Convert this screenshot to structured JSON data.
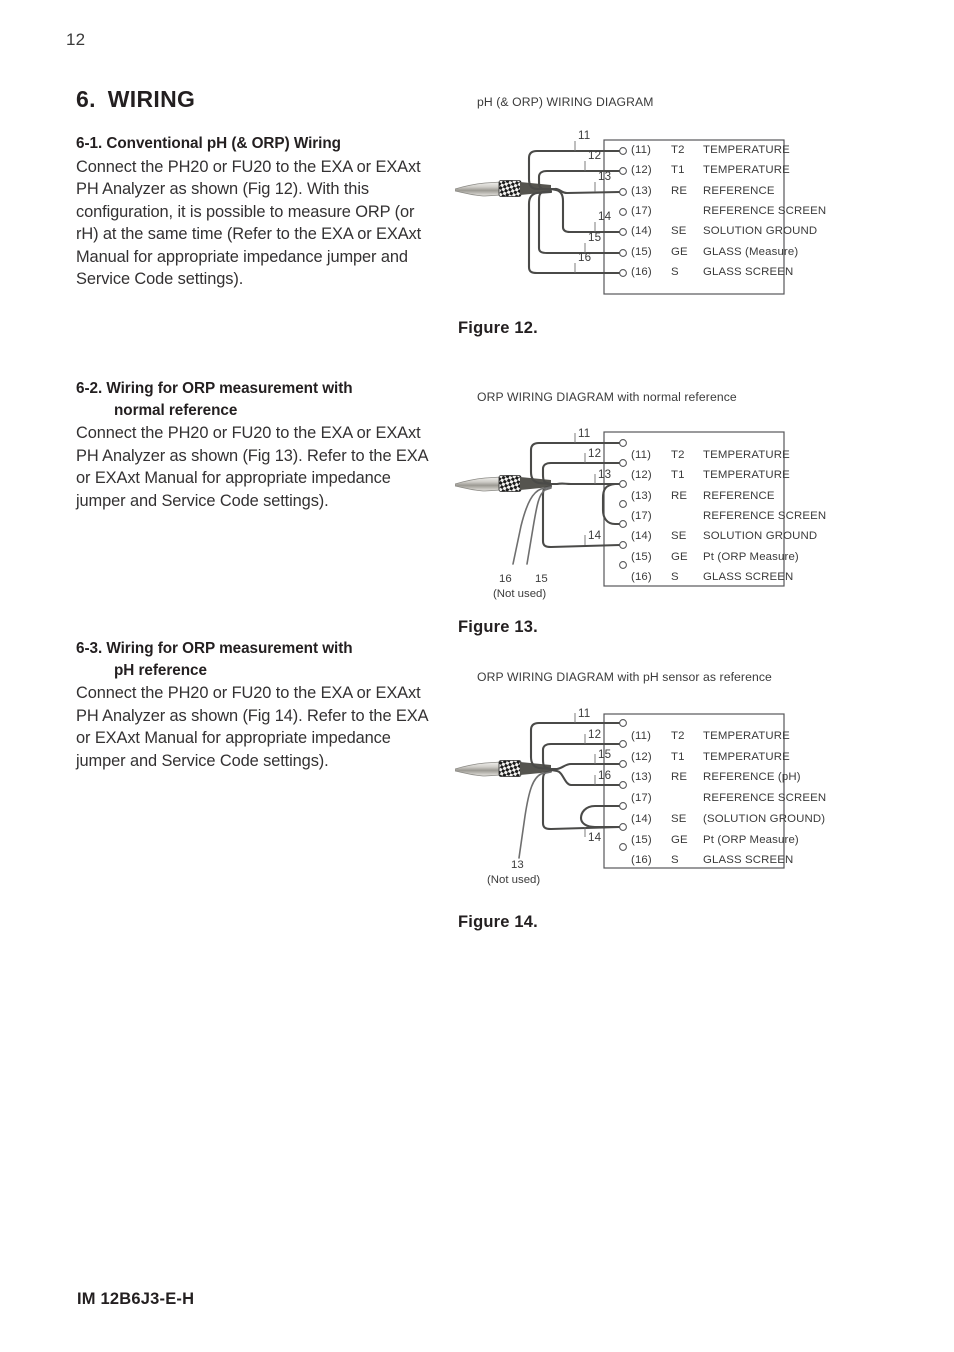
{
  "page": {
    "number": "12",
    "footer_code": "IM 12B6J3-E-H"
  },
  "chapter": {
    "number": "6.",
    "title": "WIRING"
  },
  "sections": [
    {
      "heading_line1": "6-1. Conventional pH (& ORP) Wiring",
      "heading_line2": "",
      "body": "Connect the PH20 or FU20 to the EXA or EXAxt PH Analyzer as shown (Fig 12). With this configuration, it is possible to measure ORP (or rH) at the same time (Refer to the EXA or EXAxt Manual for appropriate impedance jumper and Service Code settings)."
    },
    {
      "heading_line1": "6-2. Wiring for ORP measurement with",
      "heading_line2": "normal reference",
      "body": "Connect the PH20 or FU20 to the EXA or EXAxt PH Analyzer as shown (Fig 13). Refer to the EXA or EXAxt Manual for appropriate impedance jumper and Service Code settings)."
    },
    {
      "heading_line1": "6-3. Wiring for ORP measurement with",
      "heading_line2": "pH reference",
      "body": "Connect the PH20 or FU20 to the EXA or EXAxt PH Analyzer as shown (Fig 14). Refer to the EXA or EXAxt Manual for appropriate impedance jumper and Service Code settings)."
    }
  ],
  "figures": [
    {
      "id": "fig-12",
      "heading": "pH (& ORP) WIRING DIAGRAM",
      "caption": "Figure 12.",
      "terminals": [
        {
          "num": "(11)",
          "code": "T2",
          "desc": "TEMPERATURE"
        },
        {
          "num": "(12)",
          "code": "T1",
          "desc": "TEMPERATURE"
        },
        {
          "num": "(13)",
          "code": "RE",
          "desc": "REFERENCE"
        },
        {
          "num": "(17)",
          "code": "",
          "desc": "REFERENCE SCREEN"
        },
        {
          "num": "(14)",
          "code": "SE",
          "desc": "SOLUTION GROUND"
        },
        {
          "num": "(15)",
          "code": "GE",
          "desc": "GLASS (Measure)"
        },
        {
          "num": "(16)",
          "code": "S",
          "desc": "GLASS SCREEN"
        }
      ],
      "wire_labels": [
        "11",
        "12",
        "13",
        "14",
        "15",
        "16"
      ],
      "not_used": null
    },
    {
      "id": "fig-13",
      "heading": "ORP WIRING DIAGRAM with normal reference",
      "caption": "Figure 13.",
      "terminals": [
        {
          "num": "(11)",
          "code": "T2",
          "desc": "TEMPERATURE"
        },
        {
          "num": "(12)",
          "code": "T1",
          "desc": "TEMPERATURE"
        },
        {
          "num": "(13)",
          "code": "RE",
          "desc": "REFERENCE"
        },
        {
          "num": "(17)",
          "code": "",
          "desc": "REFERENCE SCREEN"
        },
        {
          "num": "(14)",
          "code": "SE",
          "desc": "SOLUTION GROUND"
        },
        {
          "num": "(15)",
          "code": "GE",
          "desc": "Pt (ORP Measure)"
        },
        {
          "num": "(16)",
          "code": "S",
          "desc": "GLASS SCREEN"
        }
      ],
      "wire_labels": [
        "11",
        "12",
        "13",
        "14"
      ],
      "not_used": {
        "labels": [
          "16",
          "15"
        ],
        "text": "(Not used)"
      }
    },
    {
      "id": "fig-14",
      "heading": "ORP WIRING DIAGRAM with pH sensor as reference",
      "caption": "Figure 14.",
      "terminals": [
        {
          "num": "(11)",
          "code": "T2",
          "desc": "TEMPERATURE"
        },
        {
          "num": "(12)",
          "code": "T1",
          "desc": "TEMPERATURE"
        },
        {
          "num": "(13)",
          "code": "RE",
          "desc": "REFERENCE (pH)"
        },
        {
          "num": "(17)",
          "code": "",
          "desc": "REFERENCE SCREEN"
        },
        {
          "num": "(14)",
          "code": "SE",
          "desc": "(SOLUTION GROUND)"
        },
        {
          "num": "(15)",
          "code": "GE",
          "desc": "Pt (ORP Measure)"
        },
        {
          "num": "(16)",
          "code": "S",
          "desc": "GLASS SCREEN"
        }
      ],
      "wire_labels": [
        "11",
        "12",
        "15",
        "16",
        "14"
      ],
      "not_used": {
        "labels": [
          "13"
        ],
        "text": "(Not used)"
      }
    }
  ],
  "colors": {
    "text": "#231f20",
    "muted_text": "#3b3b3b",
    "wire": "#4a4a48",
    "box_border": "#58585a",
    "cable_light": "#d8d6d2"
  }
}
